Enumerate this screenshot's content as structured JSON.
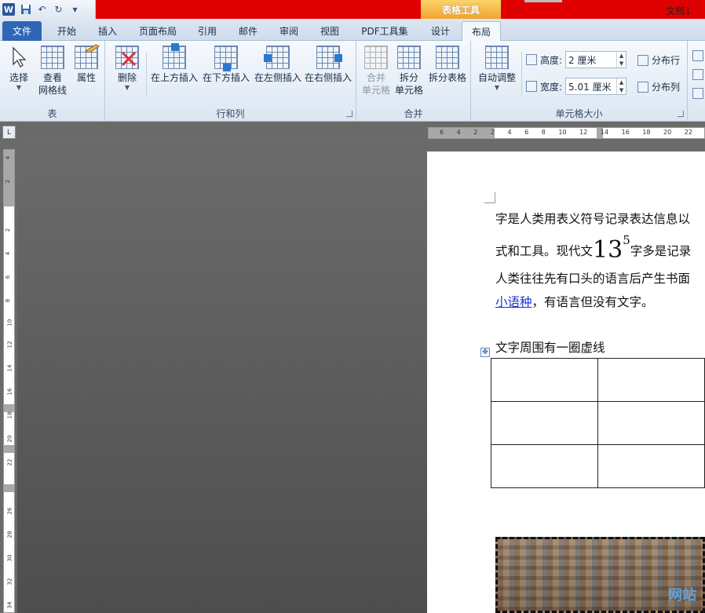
{
  "title_bar": {
    "context_tab_group": "表格工具",
    "document_title": "文档1"
  },
  "quick_access": {
    "icons": [
      "word-logo-icon",
      "save-icon",
      "undo-icon",
      "redo-icon",
      "customize-icon"
    ],
    "logo_letter": "W",
    "undo_glyph": "↶",
    "redo_glyph": "↻",
    "customize_glyph": "▾"
  },
  "tabs": {
    "file": "文件",
    "home": "开始",
    "insert": "插入",
    "page_layout": "页面布局",
    "references": "引用",
    "mailings": "邮件",
    "review": "审阅",
    "view": "视图",
    "pdf_tools": "PDF工具集",
    "design": "设计",
    "layout": "布局"
  },
  "ribbon": {
    "table_group": {
      "label": "表",
      "select": "选择",
      "view_gridlines_line1": "查看",
      "view_gridlines_line2": "网格线",
      "properties": "属性"
    },
    "rows_cols_group": {
      "label": "行和列",
      "delete": "删除",
      "insert_above": "在上方插入",
      "insert_below": "在下方插入",
      "insert_left": "在左侧插入",
      "insert_right": "在右侧插入"
    },
    "merge_group": {
      "label": "合并",
      "merge_line1": "合并",
      "merge_line2": "单元格",
      "split_line1": "拆分",
      "split_line2": "单元格",
      "split_table": "拆分表格"
    },
    "cell_size_group": {
      "label": "单元格大小",
      "autofit": "自动调整",
      "height_label": "高度:",
      "height_value": "2 厘米",
      "width_label": "宽度:",
      "width_value": "5.01 厘米",
      "distribute_rows": "分布行",
      "distribute_cols": "分布列"
    }
  },
  "ruler": {
    "corner_glyph": "L",
    "h_numbers": "6 4 2 2 4 6 8 10 12 14 16 18 20 22",
    "v_numbers": [
      "4",
      "2",
      "2",
      "4",
      "6",
      "8",
      "10",
      "12",
      "14",
      "16",
      "18",
      "20",
      "22",
      "26",
      "28",
      "30",
      "32",
      "34"
    ]
  },
  "document": {
    "line1": "字是人类用表义符号记录表达信息以",
    "line2_before": "式和工具。现代文",
    "line2_big": "13",
    "line2_sup": "5",
    "line2_after": "字多是记录",
    "line3": "人类往往先有口头的语言后产生书面",
    "line4_link": "小语种",
    "line4_after": "，有语言但没有文字。",
    "table_caption": "文字周围有一圈虚线",
    "table_handle_glyph": "✥",
    "table_rows": 3,
    "table_cols": 2,
    "watermark": "网站"
  }
}
